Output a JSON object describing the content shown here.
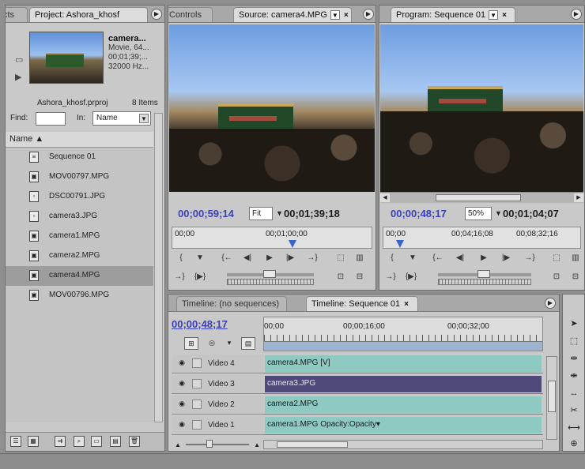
{
  "project": {
    "tab_left_fragment": "cts",
    "tab_label": "Project: Ashora_khosf",
    "preview": {
      "name": "camera...",
      "type": "Movie, 64...",
      "duration": "00;01;39;...",
      "audio": "32000 Hz..."
    },
    "project_file": "Ashora_khosf.prproj",
    "item_count": "8 Items",
    "find_label": "Find:",
    "find_value": "",
    "in_label": "In:",
    "in_value": "Name",
    "column_name": "Name",
    "items": [
      {
        "label": "Sequence 01",
        "icon": "sequence-icon"
      },
      {
        "label": "MOV00797.MPG",
        "icon": "movie-icon"
      },
      {
        "label": "DSC00791.JPG",
        "icon": "still-icon"
      },
      {
        "label": "camera3.JPG",
        "icon": "still-icon"
      },
      {
        "label": "camera1.MPG",
        "icon": "movie-icon"
      },
      {
        "label": "camera2.MPG",
        "icon": "movie-icon"
      },
      {
        "label": "camera4.MPG",
        "icon": "movie-icon"
      },
      {
        "label": "MOV00796.MPG",
        "icon": "movie-icon"
      }
    ],
    "selected_index": 6
  },
  "source": {
    "tab_left": "Controls",
    "tab_label": "Source: camera4.MPG",
    "timecode_current": "00;00;59;14",
    "fit": "Fit",
    "timecode_duration": "00;01;39;18",
    "ruler_start": "00;00",
    "ruler_mid": "00;01;00;00"
  },
  "program": {
    "tab_label": "Program: Sequence 01",
    "timecode_current": "00;00;48;17",
    "zoom": "50%",
    "timecode_duration": "00;01;04;07",
    "ruler_start": "00;00",
    "ruler_mid": "00;04;16;08",
    "ruler_end": "00;08;32;16"
  },
  "timeline": {
    "tab_empty": "Timeline: (no sequences)",
    "tab_active": "Timeline: Sequence 01",
    "timecode": "00;00;48;17",
    "ruler": [
      "00;00",
      "00;00;16;00",
      "00;00;32;00"
    ],
    "tracks": [
      {
        "name": "Video 4",
        "clip": "camera4.MPG [V]",
        "color": "#8ec9c2"
      },
      {
        "name": "Video 3",
        "clip": "camera3.JPG",
        "color": "#4f4a7a"
      },
      {
        "name": "Video 2",
        "clip": "camera2.MPG",
        "color": "#8ec9c2"
      },
      {
        "name": "Video 1",
        "clip": "camera1.MPG  Opacity:Opacity▾",
        "color": "#8ec9c2"
      }
    ]
  },
  "colors": {
    "timecode_blue": "#3a3fb5",
    "panel_bg": "#c9c9c9",
    "clip_teal": "#8ec9c2",
    "clip_purple": "#4f4a7a"
  }
}
